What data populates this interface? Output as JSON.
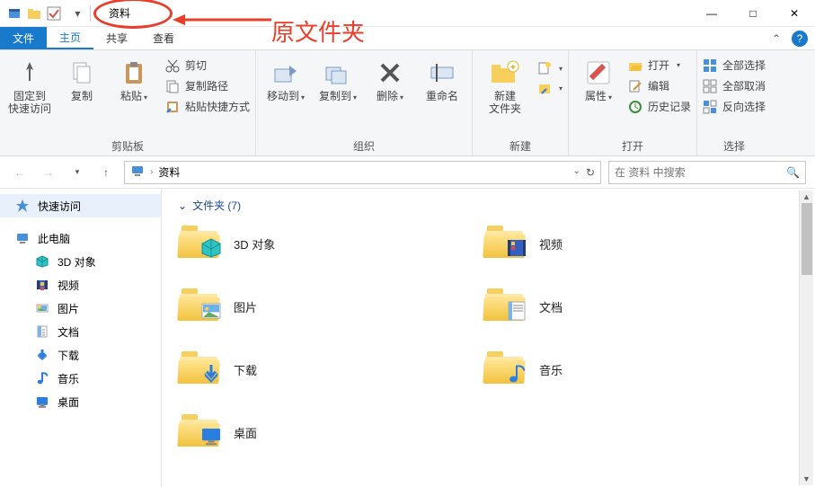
{
  "annotation": {
    "label": "原文件夹"
  },
  "titlebar": {
    "title": "资料",
    "sys": {
      "min": "—",
      "max": "□",
      "close": "✕"
    }
  },
  "tabs": {
    "file": "文件",
    "home": "主页",
    "share": "共享",
    "view": "查看"
  },
  "ribbon": {
    "clipboard": {
      "pin": "固定到\n快速访问",
      "copy": "复制",
      "paste": "粘贴",
      "cut": "剪切",
      "copypath": "复制路径",
      "pasteShortcut": "粘贴快捷方式",
      "group": "剪贴板"
    },
    "organize": {
      "moveto": "移动到",
      "copyto": "复制到",
      "delete": "删除",
      "rename": "重命名",
      "group": "组织"
    },
    "new": {
      "newfolder": "新建\n文件夹",
      "group": "新建"
    },
    "open": {
      "properties": "属性",
      "open": "打开",
      "edit": "编辑",
      "history": "历史记录",
      "group": "打开"
    },
    "select": {
      "selectall": "全部选择",
      "selectnone": "全部取消",
      "invert": "反向选择",
      "group": "选择"
    }
  },
  "nav": {
    "path": "资料",
    "refresh_icon": "refresh",
    "search_placeholder": "在 资料 中搜索"
  },
  "sidebar": {
    "quick": "快速访问",
    "thispc": "此电脑",
    "items": [
      {
        "label": "3D 对象",
        "icon": "cube"
      },
      {
        "label": "视频",
        "icon": "video"
      },
      {
        "label": "图片",
        "icon": "image"
      },
      {
        "label": "文档",
        "icon": "doc"
      },
      {
        "label": "下载",
        "icon": "download"
      },
      {
        "label": "音乐",
        "icon": "music"
      },
      {
        "label": "桌面",
        "icon": "desktop"
      }
    ]
  },
  "content": {
    "section": "文件夹 (7)",
    "folders": [
      {
        "name": "3D 对象",
        "overlay": "cube"
      },
      {
        "name": "视频",
        "overlay": "video"
      },
      {
        "name": "图片",
        "overlay": "image"
      },
      {
        "name": "文档",
        "overlay": "doc"
      },
      {
        "name": "下载",
        "overlay": "download"
      },
      {
        "name": "音乐",
        "overlay": "music"
      },
      {
        "name": "桌面",
        "overlay": "desktop"
      }
    ]
  }
}
